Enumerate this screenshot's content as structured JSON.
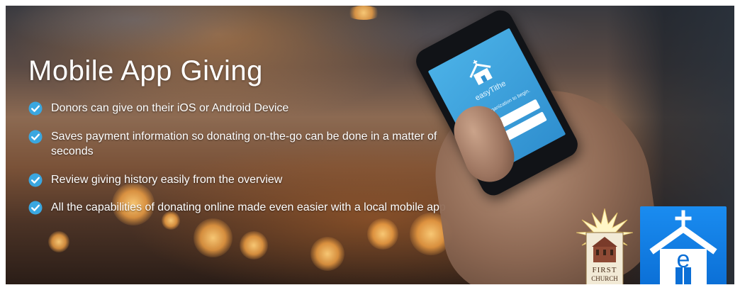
{
  "banner": {
    "title": "Mobile App Giving",
    "features": [
      {
        "text": "Donors can give on their iOS or Android Device",
        "icon": "check-circle-icon"
      },
      {
        "text": "Saves payment information so donating on-the-go can be done in a matter of seconds",
        "icon": "check-circle-icon"
      },
      {
        "text": "Review giving history easily from the overview",
        "icon": "check-circle-icon"
      },
      {
        "text": "All the capabilities of donating online made even easier with a local mobile app",
        "icon": "check-circle-icon"
      }
    ]
  },
  "phone_screen": {
    "brand": "easyTithe",
    "prompt": "Find your organization to begin."
  },
  "church_logo": {
    "line1": "FIRST",
    "line2": "CHURCH"
  },
  "colors": {
    "check": "#3aa7e0",
    "app_icon_blue": "#0b6fd6",
    "phone_screen_blue": "#2f8fcf"
  }
}
